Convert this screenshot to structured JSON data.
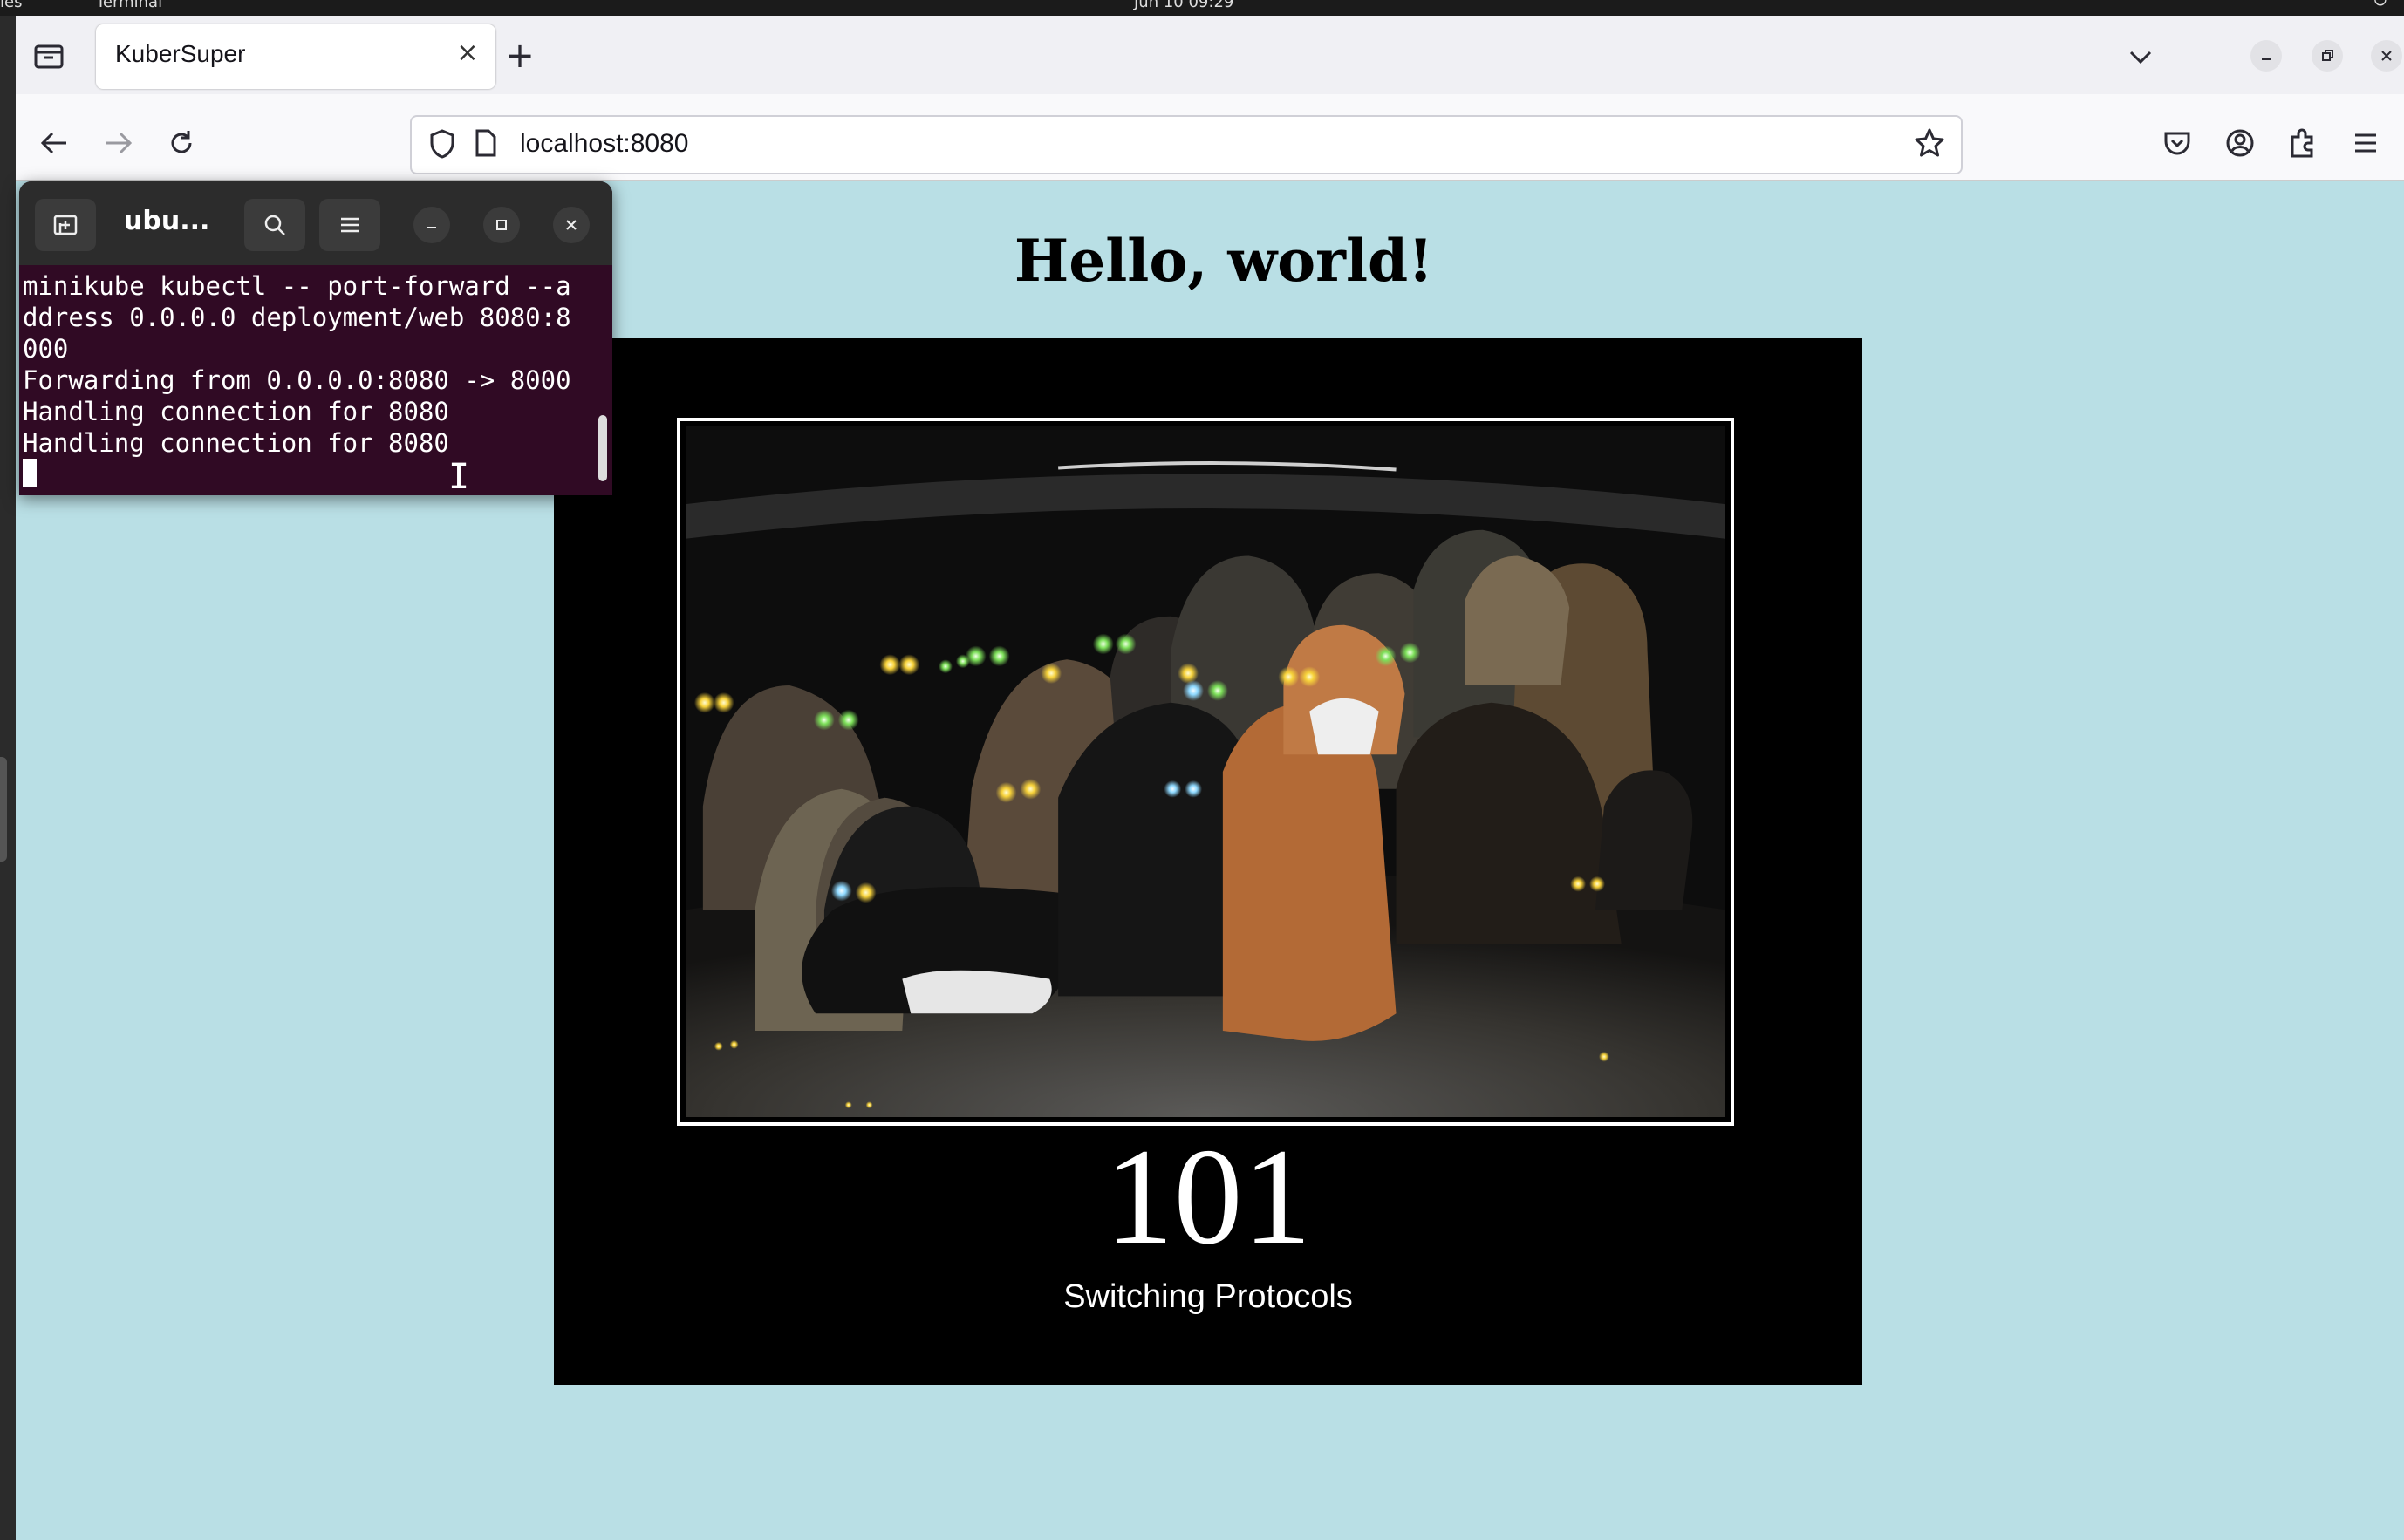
{
  "desktop": {
    "activities": "ies",
    "task_label": "Terminal",
    "clock": "Jun 10  09:29"
  },
  "browser": {
    "tab_title": "KuberSuper",
    "url": "localhost:8080"
  },
  "page": {
    "heading": "Hello, world!",
    "poster_number": "101",
    "poster_caption": "Switching Protocols",
    "background_color": "#b9dfe5"
  },
  "terminal": {
    "title": "ubu...",
    "lines": [
      "minikube kubectl -- port-forward --a",
      "ddress 0.0.0.0 deployment/web 8080:8",
      "000",
      "Forwarding from 0.0.0.0:8080 -> 8000",
      "Handling connection for 8080",
      "Handling connection for 8080"
    ],
    "background_color": "#300a24"
  }
}
